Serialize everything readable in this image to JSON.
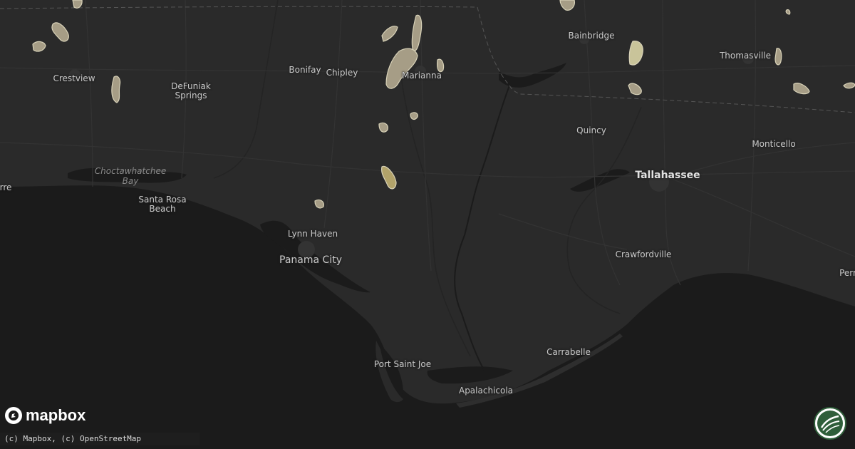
{
  "map": {
    "cities": [
      {
        "id": "crestview",
        "label": "Crestview",
        "kind": "normal"
      },
      {
        "id": "defuniak-springs",
        "label": "DeFuniak\nSprings",
        "kind": "normal"
      },
      {
        "id": "bonifay",
        "label": "Bonifay",
        "kind": "normal"
      },
      {
        "id": "chipley",
        "label": "Chipley",
        "kind": "normal"
      },
      {
        "id": "marianna",
        "label": "Marianna",
        "kind": "normal"
      },
      {
        "id": "bainbridge",
        "label": "Bainbridge",
        "kind": "normal"
      },
      {
        "id": "thomasville",
        "label": "Thomasville",
        "kind": "normal"
      },
      {
        "id": "quincy",
        "label": "Quincy",
        "kind": "normal"
      },
      {
        "id": "monticello",
        "label": "Monticello",
        "kind": "normal"
      },
      {
        "id": "tallahassee",
        "label": "Tallahassee",
        "kind": "big"
      },
      {
        "id": "santa-rosa-beach",
        "label": "Santa Rosa\nBeach",
        "kind": "normal"
      },
      {
        "id": "lynn-haven",
        "label": "Lynn Haven",
        "kind": "normal"
      },
      {
        "id": "panama-city",
        "label": "Panama City",
        "kind": "normal"
      },
      {
        "id": "crawfordville",
        "label": "Crawfordville",
        "kind": "normal"
      },
      {
        "id": "perry",
        "label": "Perr",
        "kind": "normal"
      },
      {
        "id": "port-saint-joe",
        "label": "Port Saint Joe",
        "kind": "normal"
      },
      {
        "id": "carrabelle",
        "label": "Carrabelle",
        "kind": "normal"
      },
      {
        "id": "apalachicola",
        "label": "Apalachicola",
        "kind": "normal"
      },
      {
        "id": "milton",
        "label": "rre",
        "kind": "normal"
      }
    ],
    "water_labels": [
      {
        "id": "choctawhatchee-bay",
        "label": "Choctawhatchee\nBay"
      }
    ],
    "colors": {
      "land": "#2a2a2a",
      "water": "#1b1b1b",
      "hail_fill": "#a69d86",
      "hail_bright": "#c9c49a",
      "hail_gold": "#b2a36a"
    }
  },
  "branding": {
    "logo_text": "mapbox",
    "logo_icon": "mapbox-logo-icon",
    "attribution": "(c) Mapbox, (c) OpenStreetMap",
    "badge_icon": "site-badge-icon"
  }
}
